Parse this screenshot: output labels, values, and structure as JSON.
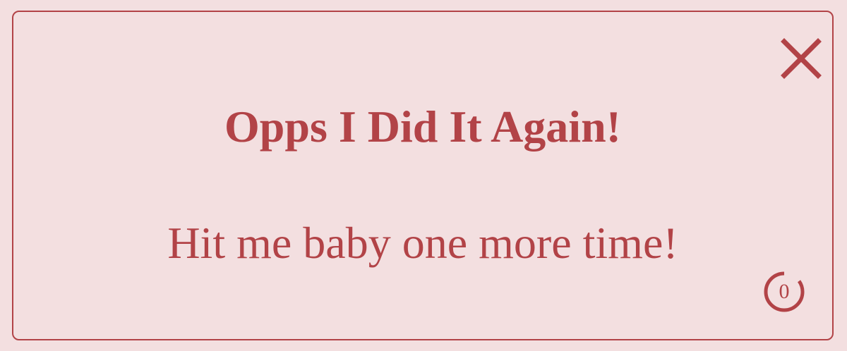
{
  "toast": {
    "title": "Opps I Did It Again!",
    "message": "Hit me baby one more time!",
    "timer_count": "0",
    "timer_progress": 0.85
  },
  "icons": {
    "close": "close-icon",
    "timer": "countdown-ring-icon"
  },
  "colors": {
    "accent": "#b24347",
    "background": "#f3dfe0"
  }
}
